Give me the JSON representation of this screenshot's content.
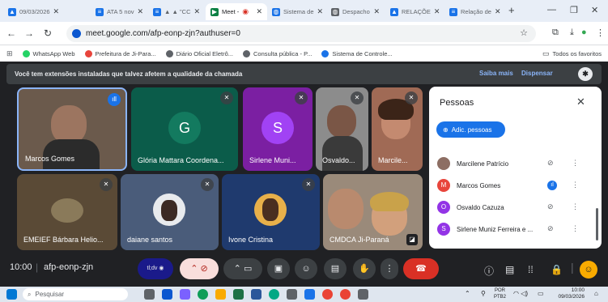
{
  "browser": {
    "tabs": [
      {
        "label": "09/03/2026",
        "color": "#1a73e8"
      },
      {
        "label": "ATA 5 nov",
        "color": "#1a73e8"
      },
      {
        "label": "▲ ▲ \"CC",
        "color": "#1a73e8"
      },
      {
        "label": "Meet -",
        "color": "#0b8043"
      },
      {
        "label": "Sistema de",
        "color": "#1a73e8"
      },
      {
        "label": "Despacho",
        "color": "#5f6368"
      },
      {
        "label": "RELAÇÕE",
        "color": "#1a73e8"
      },
      {
        "label": "Relação de",
        "color": "#1a73e8"
      }
    ],
    "url": "meet.google.com/afp-eonp-zjn?authuser=0",
    "bookmarks": [
      "WhatsApp Web",
      "Prefeitura de Ji-Para...",
      "Diário Oficial Eletrô...",
      "Consulta pública - P...",
      "Sistema de Controle..."
    ],
    "all_bookmarks": "Todos os favoritos"
  },
  "notice": {
    "text": "Você tem extensões instaladas que talvez afetem a qualidade da chamada",
    "learn_more": "Saiba mais",
    "dismiss": "Dispensar"
  },
  "tiles": {
    "marcos": "Marcos Gomes",
    "gloria": "Glória Mattara Coordena...",
    "gloria_initial": "G",
    "sirlene": "Sirlene Muni...",
    "sirlene_initial": "S",
    "osvaldo": "Osvaldo...",
    "marcilene": "Marcile...",
    "emeief": "EMEIEF Bárbara Helio...",
    "daiane": "daiane santos",
    "ivone": "Ivone Cristina",
    "cmdca": "CMDCA Ji-Paraná"
  },
  "people_panel": {
    "title": "Pessoas",
    "add_button": "Adic. pessoas",
    "participants": [
      {
        "name": "Marcilene Patrício",
        "initial": "",
        "color": "#8d6e63"
      },
      {
        "name": "Marcos Gomes",
        "initial": "M",
        "color": "#e8453c"
      },
      {
        "name": "Osvaldo Cazuza",
        "initial": "O",
        "color": "#9334e6"
      },
      {
        "name": "Sirlene Muniz Ferreira e ...",
        "initial": "S",
        "color": "#9334e6"
      }
    ]
  },
  "controls": {
    "time": "10:00",
    "meeting_code": "afp-eonp-zjn",
    "extension_label": "tl;dv"
  },
  "taskbar": {
    "search_placeholder": "Pesquisar",
    "lang": "POR",
    "lang2": "PTB2",
    "clock_time": "10:00",
    "clock_date": "09/03/2026"
  }
}
